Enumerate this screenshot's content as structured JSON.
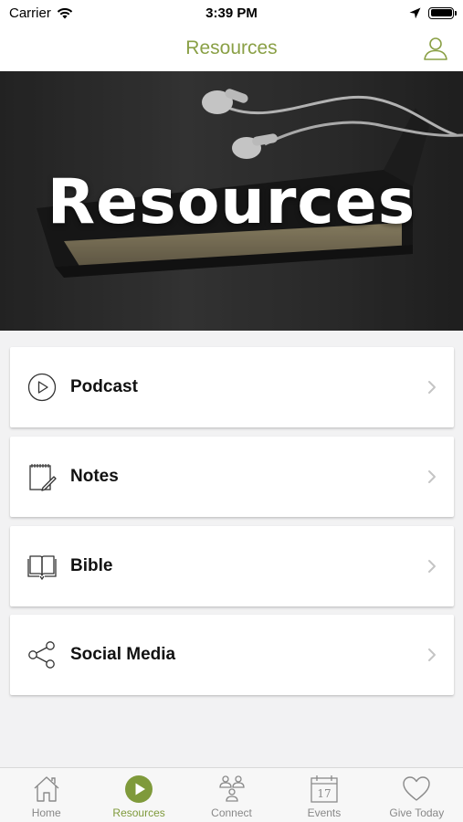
{
  "status_bar": {
    "carrier": "Carrier",
    "time": "3:39 PM"
  },
  "nav": {
    "title": "Resources"
  },
  "hero": {
    "title": "Resources"
  },
  "items": [
    {
      "label": "Podcast",
      "icon": "play-circle-icon"
    },
    {
      "label": "Notes",
      "icon": "notepad-icon"
    },
    {
      "label": "Bible",
      "icon": "book-icon"
    },
    {
      "label": "Social Media",
      "icon": "share-icon"
    }
  ],
  "tabs": [
    {
      "label": "Home",
      "icon": "home-icon",
      "active": false
    },
    {
      "label": "Resources",
      "icon": "play-icon",
      "active": true
    },
    {
      "label": "Connect",
      "icon": "people-icon",
      "active": false
    },
    {
      "label": "Events",
      "icon": "calendar-icon",
      "active": false
    },
    {
      "label": "Give Today",
      "icon": "heart-icon",
      "active": false
    }
  ],
  "colors": {
    "accent": "#8aa046",
    "tab_active": "#7f9a3b",
    "tab_inactive": "#888888",
    "background": "#f2f2f3"
  },
  "calendar_day": "17"
}
